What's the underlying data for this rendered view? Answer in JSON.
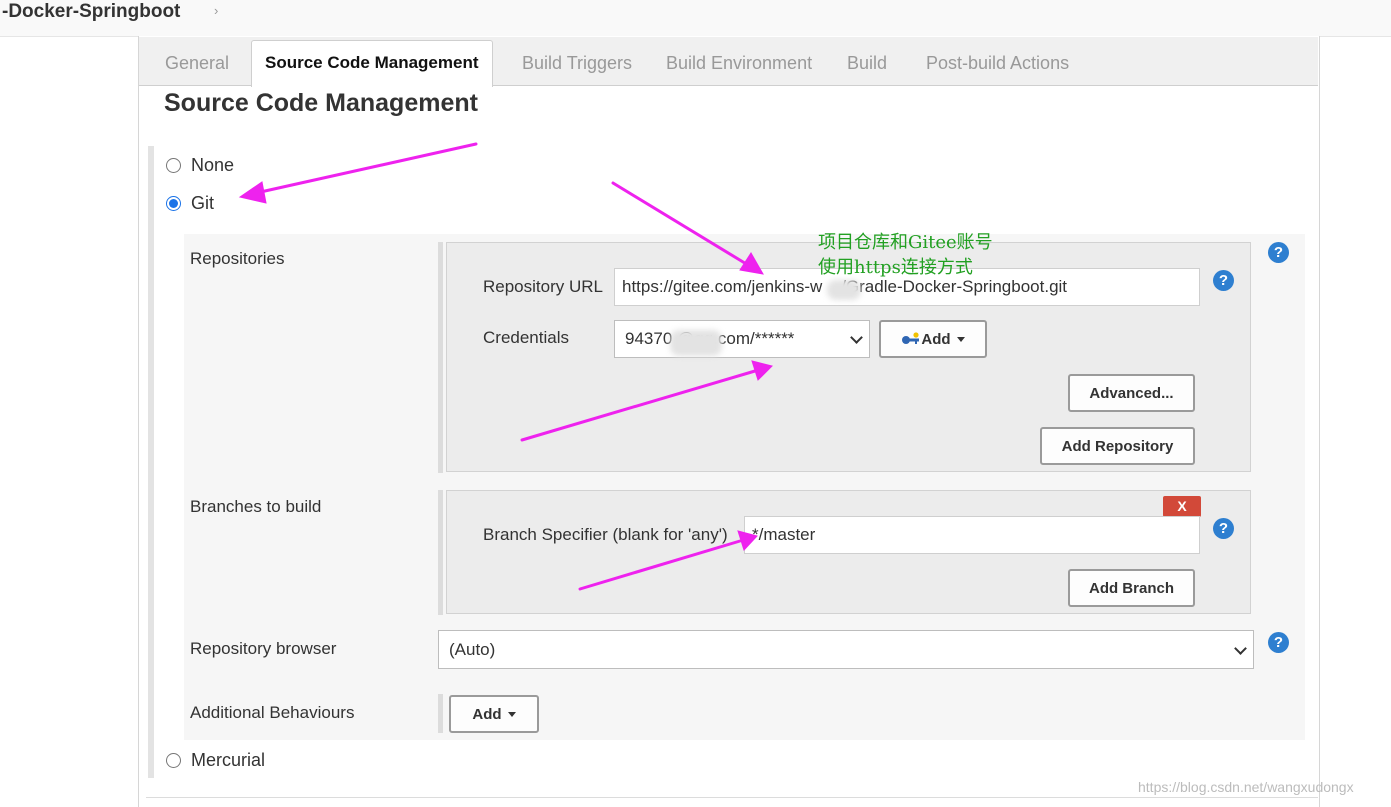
{
  "breadcrumb": {
    "title": "-Docker-Springboot",
    "chevron": "›"
  },
  "tabs": [
    {
      "label": "General",
      "active": false
    },
    {
      "label": "Source Code Management",
      "active": true
    },
    {
      "label": "Build Triggers",
      "active": false
    },
    {
      "label": "Build Environment",
      "active": false
    },
    {
      "label": "Build",
      "active": false
    },
    {
      "label": "Post-build Actions",
      "active": false
    }
  ],
  "section": {
    "title": "Source Code Management"
  },
  "scm_options": {
    "none": {
      "label": "None",
      "checked": false
    },
    "git": {
      "label": "Git",
      "checked": true
    },
    "mercurial": {
      "label": "Mercurial",
      "checked": false
    }
  },
  "repositories": {
    "label": "Repositories",
    "url_label": "Repository URL",
    "url_value": "https://gitee.com/jenkins-w    /Gradle-Docker-Springboot.git",
    "credentials_label": "Credentials",
    "credentials_value": "94370       @qq.com/******",
    "add_label": "Add",
    "advanced_label": "Advanced...",
    "add_repository_label": "Add Repository"
  },
  "branches": {
    "label": "Branches to build",
    "delete_label": "X",
    "specifier_label": "Branch Specifier (blank for 'any')",
    "specifier_value": "*/master",
    "add_branch_label": "Add Branch"
  },
  "repository_browser": {
    "label": "Repository browser",
    "value": "(Auto)"
  },
  "additional_behaviours": {
    "label": "Additional Behaviours",
    "add_label": "Add"
  },
  "help_glyph": "?",
  "annotation": {
    "line1": "项目仓库和Gitee账号",
    "line2": "使用https连接方式"
  },
  "watermark": "https://blog.csdn.net/wangxudongx",
  "colors": {
    "annotation_arrow": "#ee22ee",
    "annotation_text": "#22a022",
    "help_icon": "#2e7fd0",
    "delete_button": "#d24939",
    "radio_checked": "#1a73e8"
  }
}
